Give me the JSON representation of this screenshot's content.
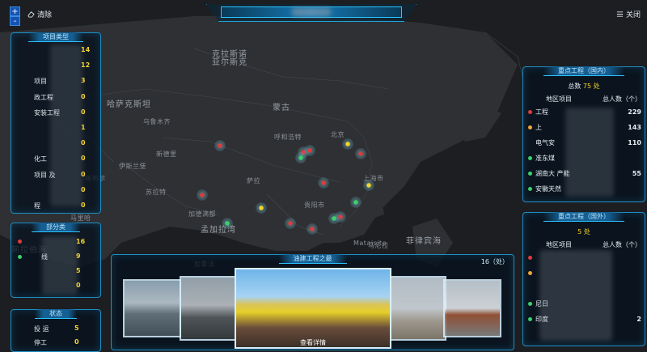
{
  "map": {
    "labels": [
      {
        "text": "克拉斯诺",
        "size": "big"
      },
      {
        "text": "亚尔斯克",
        "size": "big"
      },
      {
        "text": "哈萨克斯坦",
        "size": "big"
      },
      {
        "text": "蒙古",
        "size": "big"
      },
      {
        "text": "新德里",
        "size": "small"
      },
      {
        "text": "孟加拉湾",
        "size": "big"
      },
      {
        "text": "菲律宾海",
        "size": "big"
      },
      {
        "text": "喀布尔",
        "size": "small"
      },
      {
        "text": "伊斯兰堡",
        "size": "small"
      },
      {
        "text": "乌鲁木齐",
        "size": "small"
      },
      {
        "text": "呼和浩特",
        "size": "small"
      },
      {
        "text": "北京",
        "size": "small"
      },
      {
        "text": "上海市",
        "size": "small"
      },
      {
        "text": "贵阳市",
        "size": "small"
      },
      {
        "text": "加德满都",
        "size": "small"
      },
      {
        "text": "马尼拉",
        "size": "small"
      },
      {
        "text": "Mataisite",
        "size": "small"
      },
      {
        "text": "马里哈",
        "size": "small"
      },
      {
        "text": "苏拉特",
        "size": "small"
      },
      {
        "text": "阿拉伯海",
        "size": "big"
      },
      {
        "text": "萨拉",
        "size": "small"
      },
      {
        "text": "加拿法",
        "size": "small"
      }
    ]
  },
  "topbar": {
    "title": ""
  },
  "controls": {
    "zoom_in": "+",
    "zoom_out": "-",
    "clear": "清除",
    "close": "关闭"
  },
  "project_types": {
    "title": "项目类型",
    "items": [
      {
        "label": "",
        "value": "14"
      },
      {
        "label": "",
        "value": "12"
      },
      {
        "label": "项目",
        "value": "3"
      },
      {
        "label": "政工程",
        "value": "0"
      },
      {
        "label": "安装工程",
        "value": "0"
      },
      {
        "label": "",
        "value": "1"
      },
      {
        "label": "",
        "value": "0"
      },
      {
        "label": "化工",
        "value": "0"
      },
      {
        "label": "项目 及",
        "value": "0"
      },
      {
        "label": "",
        "value": "0"
      },
      {
        "label": "程",
        "value": "0"
      }
    ]
  },
  "part_types": {
    "title": "部分类",
    "items": [
      {
        "label": "",
        "value": "16",
        "dot": "#e23a3a"
      },
      {
        "label": "线",
        "value": "9",
        "dot": "#39d16b"
      },
      {
        "label": "",
        "value": "5",
        "dot": ""
      },
      {
        "label": "",
        "value": "0",
        "dot": ""
      }
    ]
  },
  "status": {
    "title": "状态",
    "items": [
      {
        "label": "投 运",
        "value": "5"
      },
      {
        "label": "停工",
        "value": "0"
      }
    ]
  },
  "domestic": {
    "title": "重点工程（国内）",
    "total_prefix": "总数",
    "total_value": "75",
    "total_unit": "处",
    "col1": "地区项目",
    "col2": "总人数（个）",
    "rows": [
      {
        "name": "工程",
        "value": "229",
        "dot": "#e23a3a"
      },
      {
        "name": "上",
        "value": "143",
        "dot": "#f0a53a"
      },
      {
        "name": "电气安",
        "value": "110",
        "dot": ""
      },
      {
        "name": "准东煤",
        "value": "",
        "dot": "#39d16b"
      },
      {
        "name": "湖南大 产能",
        "value": "55",
        "dot": "#39d16b"
      },
      {
        "name": "安徽天然",
        "value": "",
        "dot": "#39d16b"
      }
    ]
  },
  "overseas": {
    "title": "重点工程（国外）",
    "total_value": "5",
    "total_unit": "处",
    "col1": "地区项目",
    "col2": "总人数（个）",
    "rows": [
      {
        "name": "",
        "value": "",
        "dot": "#e23a3a"
      },
      {
        "name": "",
        "value": "",
        "dot": "#f0a53a"
      },
      {
        "name": "",
        "value": "",
        "dot": ""
      },
      {
        "name": "尼日",
        "value": "",
        "dot": "#39d16b"
      },
      {
        "name": "印度",
        "value": "2",
        "dot": "#39d16b"
      }
    ]
  },
  "carousel": {
    "title": "油建工程之最",
    "count": "16（处）",
    "view_btn": "查看详情"
  },
  "colors": {
    "accent": "#1d8fc7",
    "value": "#f5d42a",
    "red": "#e23a3a",
    "green": "#39d16b",
    "orange": "#f0a53a"
  }
}
